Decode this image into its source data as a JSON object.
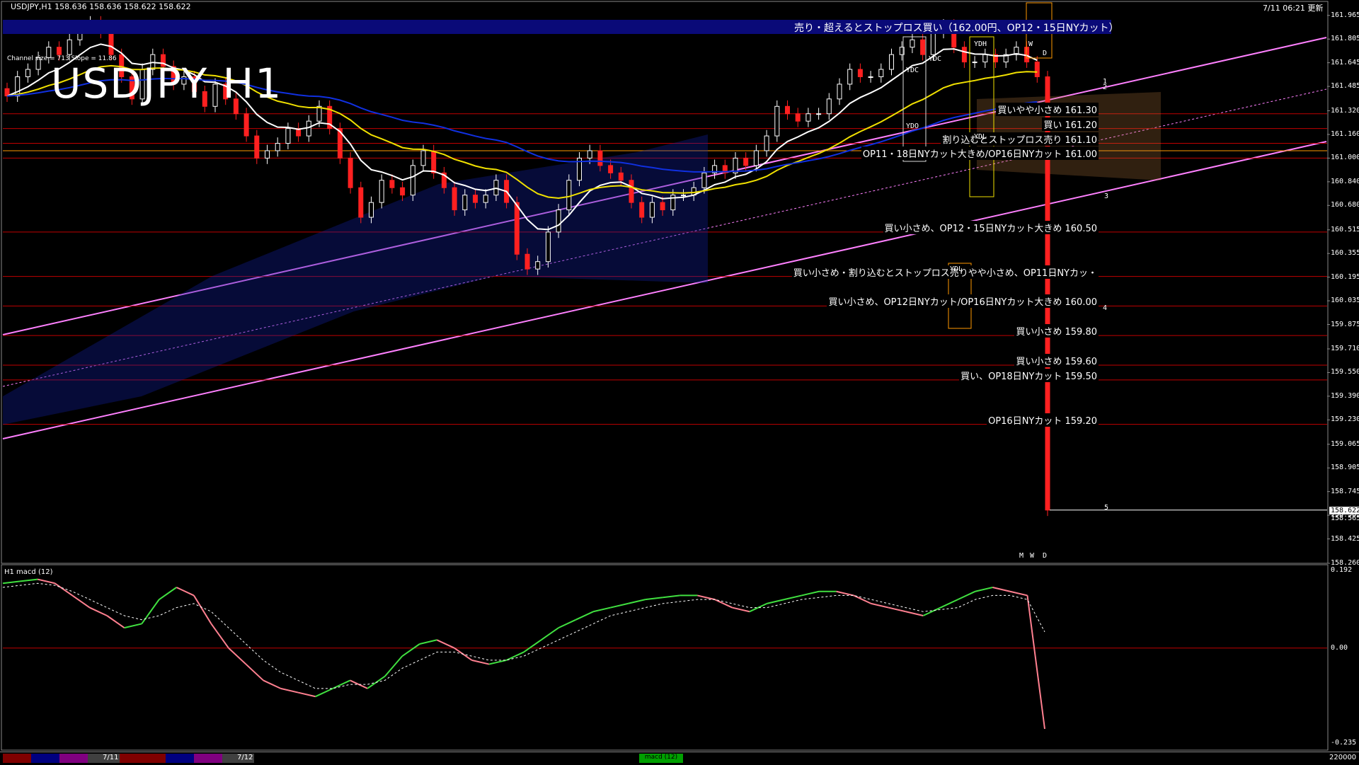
{
  "header": {
    "symbol_info": "USDJPY,H1  158.636 158.636 158.622 158.622",
    "time_info": "7/11 06:21 更新",
    "title": "USDJPY H1",
    "channel_info": "Channel size = 713 Slope = 11.86",
    "banner": "売り・超えるとストップロス買い（162.00円、OP12・15日NYカット）",
    "macd_label": "H1  macd (12)"
  },
  "colors": {
    "bull": "#ffffff",
    "bear": "#ff2020",
    "ema_white": "#ffffff",
    "ema_yellow": "#f0e000",
    "ema_blue": "#1030e0",
    "ichimoku_green": "#20c020",
    "channel": "#ff80ff",
    "level": "#c00000",
    "banner": "#0a0a78",
    "macd_up": "#40e040",
    "macd_down": "#ff8090"
  },
  "levels": [
    {
      "price": 161.3,
      "label": "買いやや小さめ 161.30"
    },
    {
      "price": 161.2,
      "label": "買い 161.20"
    },
    {
      "price": 161.1,
      "label": "割り込むとストップロス売り 161.10"
    },
    {
      "price": 161.0,
      "label": "OP11・18日NYカット大きめ/OP16日NYカット 161.00"
    },
    {
      "price": 160.5,
      "label": "買い小さめ、OP12・15日NYカット大きめ 160.50"
    },
    {
      "price": 160.2,
      "label": "買い小さめ・割り込むとストップロス売りやや小さめ、OP11日NYカッ・"
    },
    {
      "price": 160.0,
      "label": "買い小さめ、OP12日NYカット/OP16日NYカット大きめ 160.00"
    },
    {
      "price": 159.8,
      "label": "買い小さめ 159.80"
    },
    {
      "price": 159.6,
      "label": "買い小さめ 159.60"
    },
    {
      "price": 159.5,
      "label": "買い、OP18日NYカット 159.50"
    },
    {
      "price": 159.2,
      "label": "OP16日NYカット 159.20"
    }
  ],
  "box_labels": {
    "ydc": "YDC",
    "ydo": "YDO",
    "ydh": "YDH",
    "ydl": "YDL",
    "ydl2": "YDL",
    "w": "W",
    "d": "D",
    "m": "M",
    "w2": "W",
    "d2": "D"
  },
  "channel_numbers": [
    "1",
    "2",
    "3",
    "4",
    "5"
  ],
  "bottom": {
    "date1": "7/11",
    "date2": "7/12",
    "indicator_btn": "macd (12)",
    "volume_value": "220000"
  },
  "chart_data": {
    "type": "candlestick",
    "title": "USDJPY H1",
    "last_price": 158.622,
    "last_price_label": "158.622",
    "second_price_label": "158.565",
    "ylim": [
      158.26,
      162.05
    ],
    "y_ticks": [
      "161.965",
      "161.805",
      "161.645",
      "161.485",
      "161.320",
      "161.160",
      "161.000",
      "160.840",
      "160.680",
      "160.515",
      "160.355",
      "160.195",
      "160.035",
      "159.875",
      "159.710",
      "159.550",
      "159.390",
      "159.230",
      "159.065",
      "158.905",
      "158.745",
      "158.585",
      "158.425",
      "158.260"
    ],
    "close": [
      161.42,
      161.55,
      161.6,
      161.68,
      161.75,
      161.7,
      161.8,
      161.88,
      161.92,
      161.85,
      161.7,
      161.55,
      161.4,
      161.6,
      161.7,
      161.62,
      161.5,
      161.55,
      161.45,
      161.35,
      161.5,
      161.4,
      161.3,
      161.15,
      161.0,
      161.05,
      161.1,
      161.2,
      161.15,
      161.25,
      161.35,
      161.2,
      161.0,
      160.8,
      160.6,
      160.7,
      160.85,
      160.8,
      160.75,
      160.95,
      161.05,
      160.9,
      160.8,
      160.65,
      160.75,
      160.7,
      160.75,
      160.85,
      160.7,
      160.35,
      160.25,
      160.3,
      160.5,
      160.65,
      160.85,
      161.0,
      161.05,
      160.95,
      160.9,
      160.85,
      160.7,
      160.6,
      160.7,
      160.65,
      160.75,
      160.75,
      160.8,
      160.9,
      160.95,
      160.9,
      161.0,
      160.95,
      161.05,
      161.15,
      161.35,
      161.3,
      161.25,
      161.3,
      161.3,
      161.4,
      161.5,
      161.6,
      161.55,
      161.55,
      161.6,
      161.7,
      161.75,
      161.8,
      161.7,
      161.85,
      161.9,
      161.75,
      161.65,
      161.65,
      161.7,
      161.65,
      161.7,
      161.75,
      161.65,
      161.55,
      158.62
    ],
    "macd": {
      "ylim": [
        -0.235,
        0.192
      ],
      "y_ticks": [
        "0.192",
        "0.00",
        "-0.235"
      ],
      "main": [
        0.16,
        0.165,
        0.17,
        0.16,
        0.13,
        0.1,
        0.08,
        0.05,
        0.06,
        0.12,
        0.15,
        0.13,
        0.06,
        0.0,
        -0.04,
        -0.08,
        -0.1,
        -0.11,
        -0.12,
        -0.1,
        -0.08,
        -0.1,
        -0.07,
        -0.02,
        0.01,
        0.02,
        0.0,
        -0.03,
        -0.04,
        -0.03,
        -0.01,
        0.02,
        0.05,
        0.07,
        0.09,
        0.1,
        0.11,
        0.12,
        0.125,
        0.13,
        0.13,
        0.12,
        0.1,
        0.09,
        0.11,
        0.12,
        0.13,
        0.14,
        0.14,
        0.13,
        0.11,
        0.1,
        0.09,
        0.08,
        0.1,
        0.12,
        0.14,
        0.15,
        0.14,
        0.13,
        -0.2
      ],
      "signal": [
        0.15,
        0.155,
        0.16,
        0.155,
        0.14,
        0.12,
        0.1,
        0.08,
        0.07,
        0.08,
        0.1,
        0.11,
        0.09,
        0.05,
        0.01,
        -0.03,
        -0.06,
        -0.08,
        -0.1,
        -0.1,
        -0.09,
        -0.09,
        -0.08,
        -0.05,
        -0.03,
        -0.01,
        -0.01,
        -0.02,
        -0.03,
        -0.03,
        -0.02,
        0.0,
        0.02,
        0.04,
        0.06,
        0.08,
        0.09,
        0.1,
        0.11,
        0.115,
        0.12,
        0.12,
        0.11,
        0.1,
        0.1,
        0.11,
        0.12,
        0.125,
        0.13,
        0.13,
        0.12,
        0.11,
        0.1,
        0.09,
        0.095,
        0.1,
        0.12,
        0.13,
        0.13,
        0.12,
        0.04
      ]
    }
  }
}
